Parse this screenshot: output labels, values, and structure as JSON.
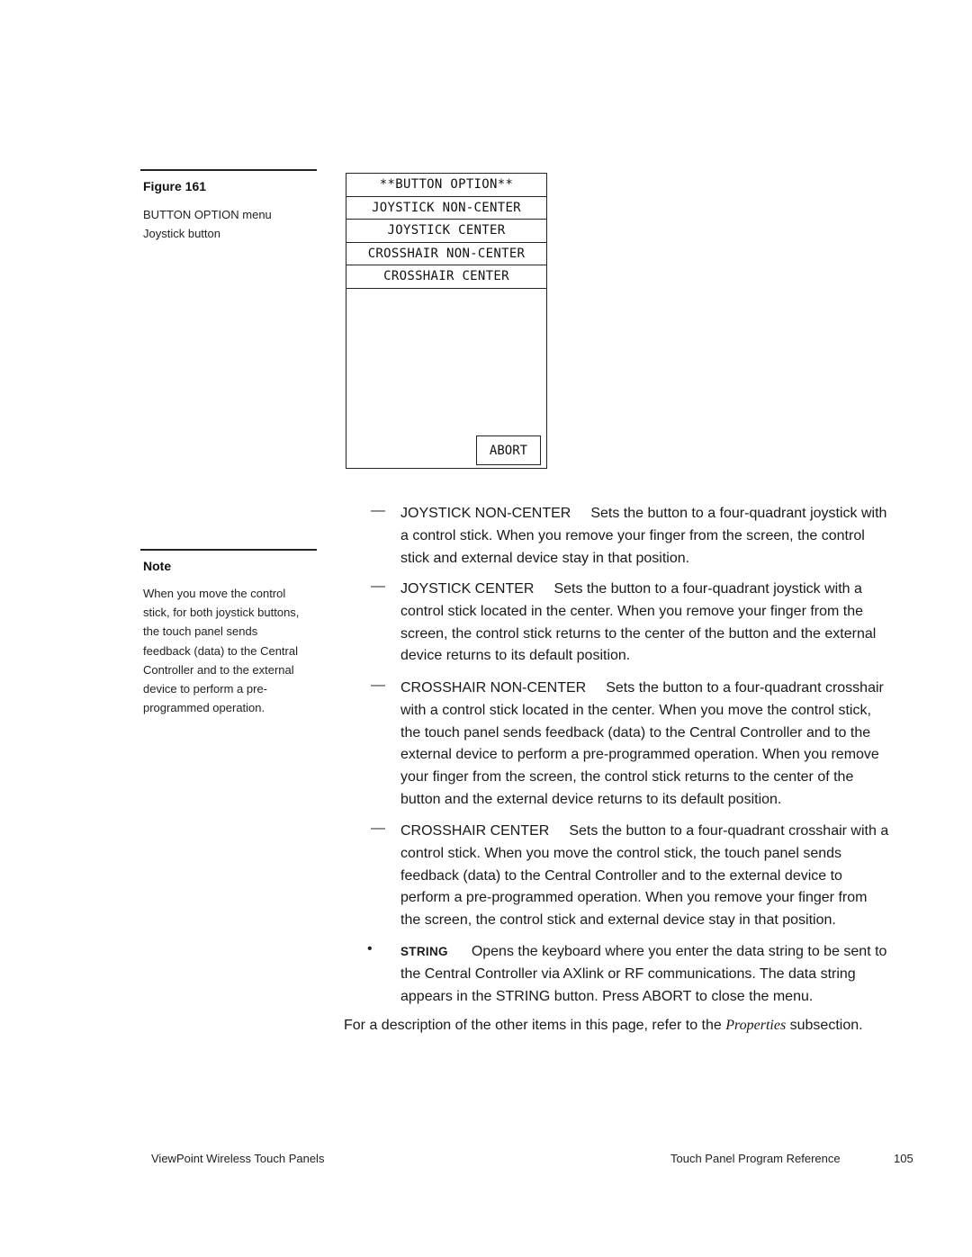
{
  "sidebar": {
    "figure": {
      "label": "Figure 161",
      "caption_line1": "BUTTON OPTION menu",
      "caption_line2": "Joystick button"
    },
    "note": {
      "heading": "Note",
      "lines": [
        "When you move the control",
        "stick, for both joystick buttons,",
        "the touch panel sends",
        "feedback (data) to the Central",
        "Controller and to the external",
        "device to perform a pre-",
        "programmed operation."
      ]
    }
  },
  "panel": {
    "title": "**BUTTON OPTION**",
    "options": [
      "JOYSTICK NON-CENTER",
      "JOYSTICK CENTER",
      "CROSSHAIR NON-CENTER",
      "CROSSHAIR CENTER"
    ],
    "abort_label": "ABORT"
  },
  "entries": [
    {
      "marker": "—",
      "term": "JOYSTICK NON-CENTER",
      "lines": [
        "Sets the button to a four-quadrant joystick with",
        "a control stick. When you remove your finger from the screen, the control",
        "stick and external device stay in that position."
      ]
    },
    {
      "marker": "—",
      "term": "JOYSTICK CENTER",
      "lines": [
        "Sets the button to a four-quadrant joystick with a",
        "control stick located in the center. When you remove your finger from the",
        "screen, the control stick returns to the center of the button and the external",
        "device returns to its default position."
      ]
    },
    {
      "marker": "—",
      "term": "CROSSHAIR NON-CENTER",
      "lines": [
        "Sets the button to a four-quadrant crosshair",
        "with a control stick located in the center. When you move the control stick,",
        "the touch panel sends feedback (data) to the Central Controller and to the",
        "external device to perform a pre-programmed operation. When you remove",
        "your finger from the screen, the control stick returns to the center of the",
        "button and the external device returns to its default position."
      ]
    },
    {
      "marker": "—",
      "term": "CROSSHAIR CENTER",
      "lines": [
        "Sets the button to a four-quadrant crosshair with a",
        "control stick. When you move the control stick, the touch panel sends",
        "feedback (data) to the Central Controller and to the external device to",
        "perform a pre-programmed operation. When you remove your finger from",
        "the screen, the control stick and external device stay in that position."
      ]
    },
    {
      "marker": "•",
      "term": "STRING",
      "lines": [
        "Opens the keyboard where you enter the data string to be sent to",
        "the Central Controller via AXlink or RF communications. The data string",
        "appears in the STRING button. Press ABORT to close the menu."
      ]
    }
  ],
  "closing": {
    "before": "For a description of the other items in this page, refer to the ",
    "link": "Properties",
    "after": " subsection."
  },
  "footer": {
    "left": "ViewPoint Wireless Touch Panels",
    "right": "Touch Panel Program Reference",
    "page_number": "105"
  }
}
